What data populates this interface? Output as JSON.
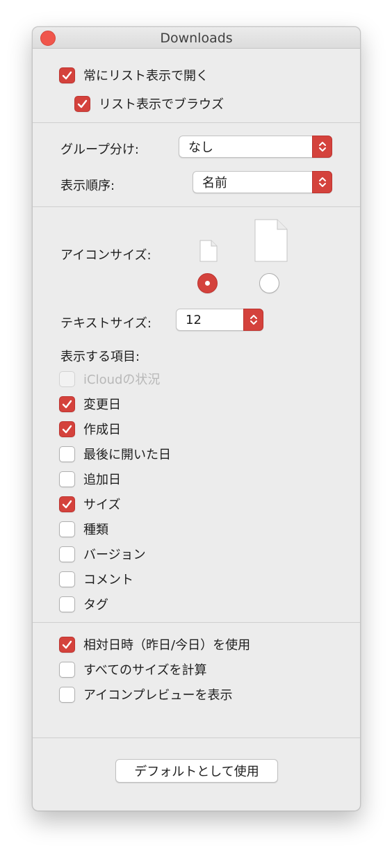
{
  "window": {
    "title": "Downloads",
    "accent_color": "#d4423c"
  },
  "section_open": {
    "always_open_list": {
      "label": "常にリスト表示で開く",
      "checked": true
    },
    "browse_list": {
      "label": "リスト表示でブラウズ",
      "checked": true
    }
  },
  "grouping": {
    "group_label": "グループ分け:",
    "group_value": "なし",
    "sort_label": "表示順序:",
    "sort_value": "名前"
  },
  "icon_size": {
    "label": "アイコンサイズ:",
    "small_icon": "small-document-icon",
    "large_icon": "large-document-icon",
    "selected": "small"
  },
  "text_size": {
    "label": "テキストサイズ:",
    "value": "12"
  },
  "columns": {
    "heading": "表示する項目:",
    "items": [
      {
        "label": "iCloudの状況",
        "checked": false,
        "disabled": true
      },
      {
        "label": "変更日",
        "checked": true,
        "disabled": false
      },
      {
        "label": "作成日",
        "checked": true,
        "disabled": false
      },
      {
        "label": "最後に開いた日",
        "checked": false,
        "disabled": false
      },
      {
        "label": "追加日",
        "checked": false,
        "disabled": false
      },
      {
        "label": "サイズ",
        "checked": true,
        "disabled": false
      },
      {
        "label": "種類",
        "checked": false,
        "disabled": false
      },
      {
        "label": "バージョン",
        "checked": false,
        "disabled": false
      },
      {
        "label": "コメント",
        "checked": false,
        "disabled": false
      },
      {
        "label": "タグ",
        "checked": false,
        "disabled": false
      }
    ]
  },
  "options": {
    "items": [
      {
        "label": "相対日時（昨日/今日）を使用",
        "checked": true
      },
      {
        "label": "すべてのサイズを計算",
        "checked": false
      },
      {
        "label": "アイコンプレビューを表示",
        "checked": false
      }
    ]
  },
  "footer": {
    "default_button": "デフォルトとして使用"
  }
}
